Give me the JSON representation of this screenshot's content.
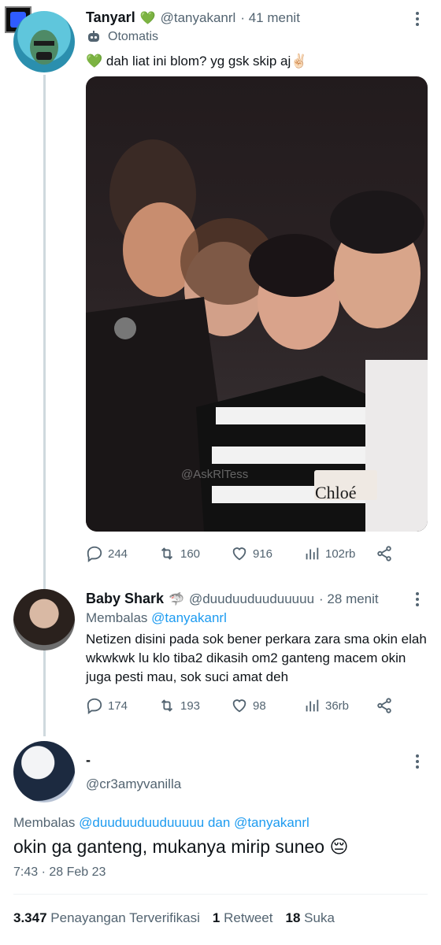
{
  "tweet1": {
    "name": "Tanyarl",
    "name_emoji": "💚",
    "handle": "@tanyakanrl",
    "time": "· 41 menit",
    "automated_label": "Otomatis",
    "text": "💚 dah liat ini blom? yg gsk skip aj✌🏻",
    "image_watermark": "@AskRlTess",
    "image_text": "Chloé",
    "stats": {
      "replies": "244",
      "retweets": "160",
      "likes": "916",
      "views": "102rb"
    }
  },
  "tweet2": {
    "name": "Baby Shark",
    "name_emoji": "🦈",
    "handle": "@duuduuduuduuuuu",
    "time": "· 28 menit",
    "reply_prefix": "Membalas",
    "reply_to": "@tanyakanrl",
    "text": "Netizen disini pada sok bener perkara zara sma okin elah wkwkwk lu klo tiba2 dikasih om2 ganteng macem okin juga pesti mau, sok suci amat deh",
    "stats": {
      "replies": "174",
      "retweets": "193",
      "likes": "98",
      "views": "36rb"
    }
  },
  "tweet3": {
    "name": "-",
    "handle": "@cr3amyvanilla",
    "reply_prefix": "Membalas",
    "reply_to_1": "@duuduuduuduuuuu",
    "reply_join": "dan",
    "reply_to_2": "@tanyakanrl",
    "text": "okin ga ganteng, mukanya mirip suneo 😔",
    "timestamp": "7:43 · 28 Feb 23",
    "views_count": "3.347",
    "views_label": "Penayangan Terverifikasi",
    "retweet_count": "1",
    "retweet_label": "Retweet",
    "like_count": "18",
    "like_label": "Suka"
  }
}
